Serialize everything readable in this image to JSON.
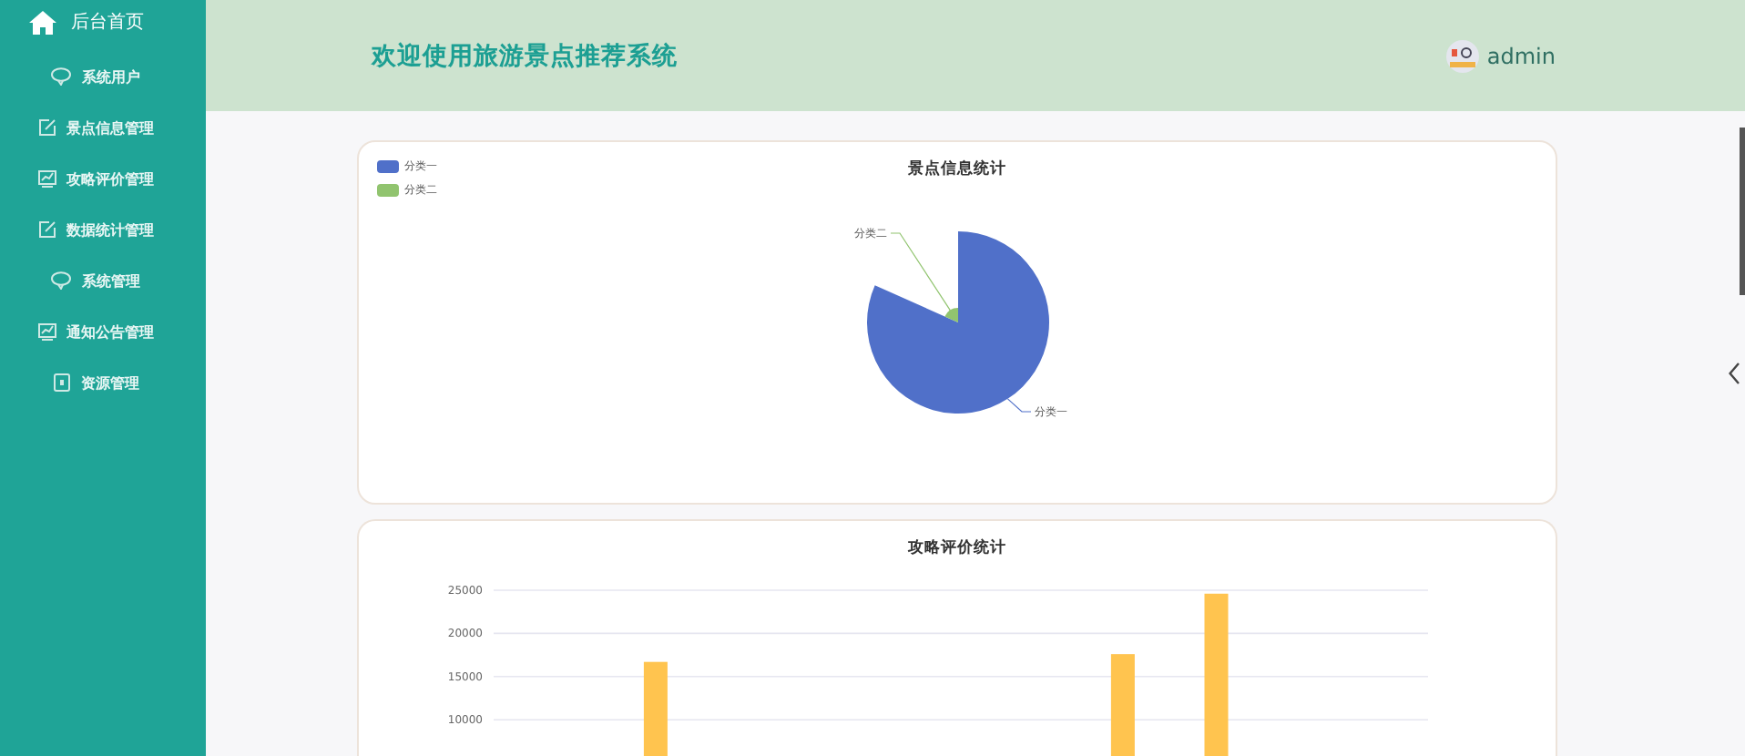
{
  "sidebar": {
    "home": "后台首页",
    "items": [
      {
        "label": "系统用户"
      },
      {
        "label": "景点信息管理"
      },
      {
        "label": "攻略评价管理"
      },
      {
        "label": "数据统计管理"
      },
      {
        "label": "系统管理"
      },
      {
        "label": "通知公告管理"
      },
      {
        "label": "资源管理"
      }
    ]
  },
  "header": {
    "title": "欢迎使用旅游景点推荐系统",
    "user": "admin"
  },
  "pie_card": {
    "title": "景点信息统计",
    "legend": [
      {
        "label": "分类一",
        "color": "#5070c9"
      },
      {
        "label": "分类二",
        "color": "#91c46f"
      }
    ],
    "slice_labels": [
      "分类一",
      "分类二"
    ]
  },
  "bar_card": {
    "title": "攻略评价统计",
    "chart_data": {
      "type": "bar",
      "grid": true,
      "yticks": [
        10000,
        15000,
        20000,
        25000
      ],
      "ylim": [
        0,
        25000
      ],
      "series": [
        {
          "color": "#ffc44f",
          "values": [
            null,
            16700,
            null,
            null,
            null,
            null,
            17600,
            24600,
            null,
            null
          ]
        }
      ]
    }
  }
}
